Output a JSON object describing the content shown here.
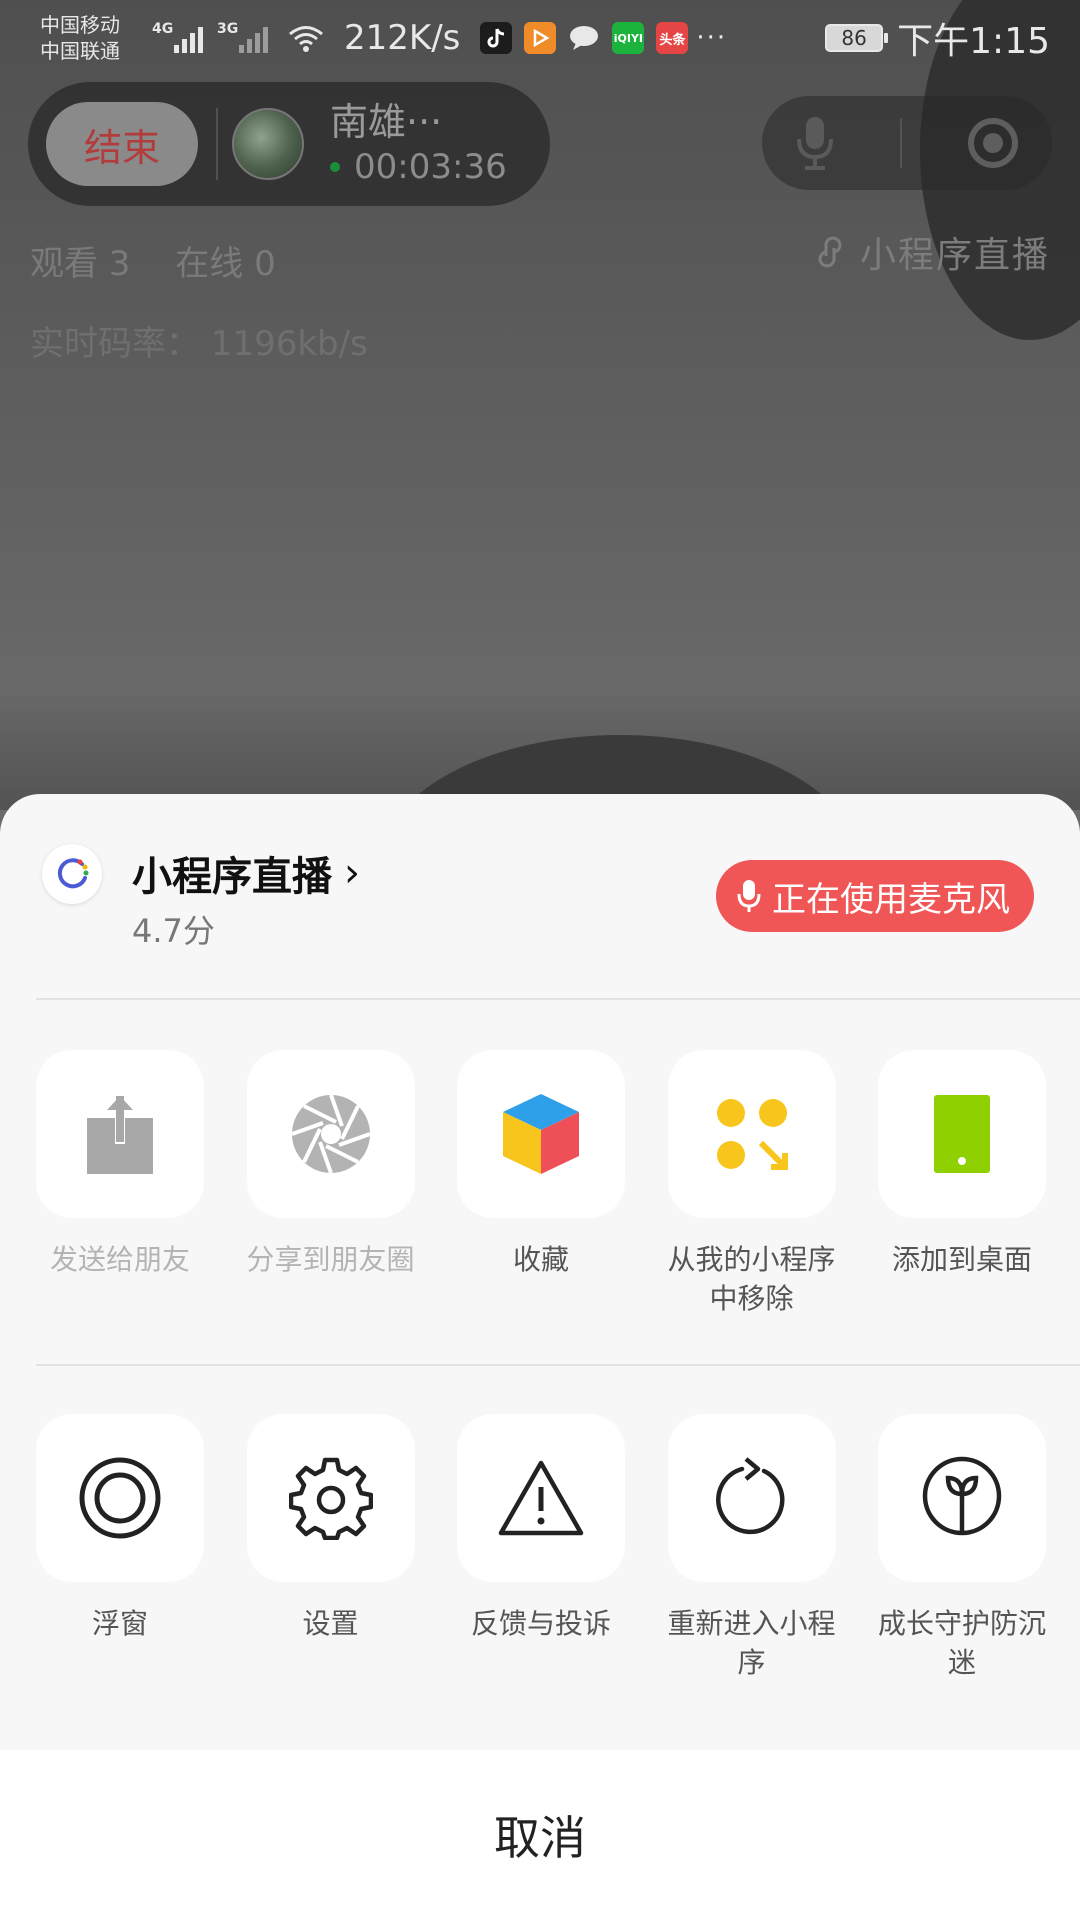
{
  "status_bar": {
    "carrier_1": "中国移动",
    "carrier_2": "中国联通",
    "net_1": "4G",
    "net_2": "3G",
    "speed": "212K/s",
    "app_icons": [
      "douyin-icon",
      "bilibili-icon",
      "message-icon",
      "iqiyi-icon",
      "toutiao-icon"
    ],
    "iqiyi_text": "iQIYI",
    "toutiao_text": "头条",
    "more": "···",
    "battery": "86",
    "time": "下午1:15"
  },
  "live": {
    "end_label": "结束",
    "host_name": "南雄···",
    "duration": "00:03:36",
    "viewers": "观看 3",
    "online": "在线 0",
    "bitrate": "实时码率：  1196kb/s",
    "mini_program_label": "小程序直播"
  },
  "sheet": {
    "app_name": "小程序直播",
    "chevron": "›",
    "score": "4.7分",
    "mic_status": "正在使用麦克风",
    "row1": [
      {
        "label": "发送给朋友",
        "icon": "share-upload-icon"
      },
      {
        "label": "分享到朋友圈",
        "icon": "moments-aperture-icon"
      },
      {
        "label": "收藏",
        "icon": "favorite-cube-icon"
      },
      {
        "label": "从我的小程序中移除",
        "icon": "remove-miniprogram-icon"
      },
      {
        "label": "添加到桌面",
        "icon": "add-to-desktop-icon"
      }
    ],
    "row2": [
      {
        "label": "浮窗",
        "icon": "float-window-icon"
      },
      {
        "label": "设置",
        "icon": "settings-gear-icon"
      },
      {
        "label": "反馈与投诉",
        "icon": "feedback-warning-icon"
      },
      {
        "label": "重新进入小程序",
        "icon": "reload-icon"
      },
      {
        "label": "成长守护防沉迷",
        "icon": "growth-guard-icon"
      }
    ],
    "cancel": "取消"
  },
  "colors": {
    "mic_badge": "#f05656",
    "favorite_top": "#2ea0ea",
    "favorite_left": "#f8c51c",
    "favorite_right": "#ef4f56",
    "remove_dots": "#f8c51c",
    "desktop_green": "#8fd000"
  }
}
